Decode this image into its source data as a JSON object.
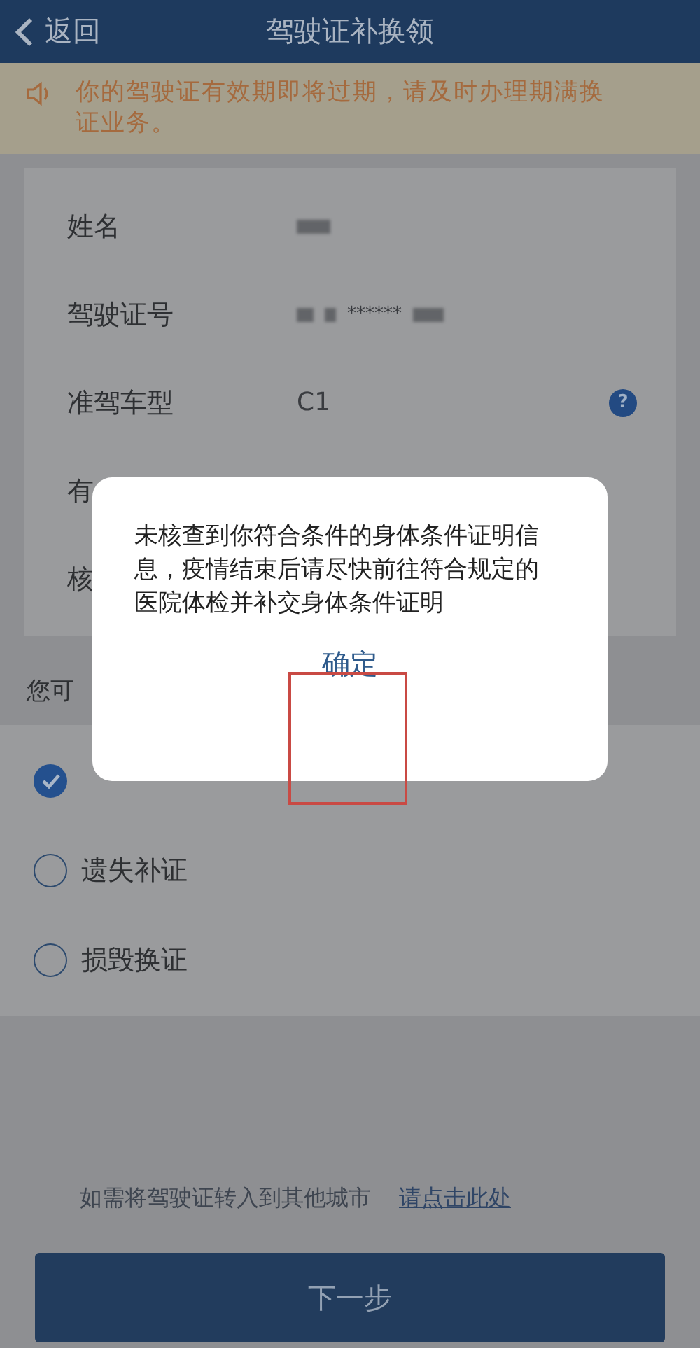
{
  "header": {
    "back": "返回",
    "title": "驾驶证补换领"
  },
  "notice": {
    "text": "你的驾驶证有效期即将过期，请及时办理期满换证业务。"
  },
  "form_rows": [
    {
      "label": "姓名",
      "kind": "redacted"
    },
    {
      "label": "驾驶证号",
      "kind": "redacted",
      "value": "******"
    },
    {
      "label": "准驾车型",
      "kind": "text",
      "value": "C1",
      "help": "?"
    },
    {
      "label": "有",
      "kind": "empty"
    },
    {
      "label": "核",
      "kind": "empty"
    }
  ],
  "section_label": "您可",
  "options": [
    {
      "selected": true
    },
    {
      "label": "遗失补证",
      "selected": false
    },
    {
      "label": "损毁换证",
      "selected": false
    }
  ],
  "footer": {
    "text": "如需将驾驶证转入到其他城市",
    "link": "请点击此处"
  },
  "next_button": "下一步",
  "dialog": {
    "message": "未核查到你符合条件的身体条件证明信息，疫情结束后请尽快前往符合规定的医院体检并补交身体条件证明",
    "confirm": "确定"
  }
}
